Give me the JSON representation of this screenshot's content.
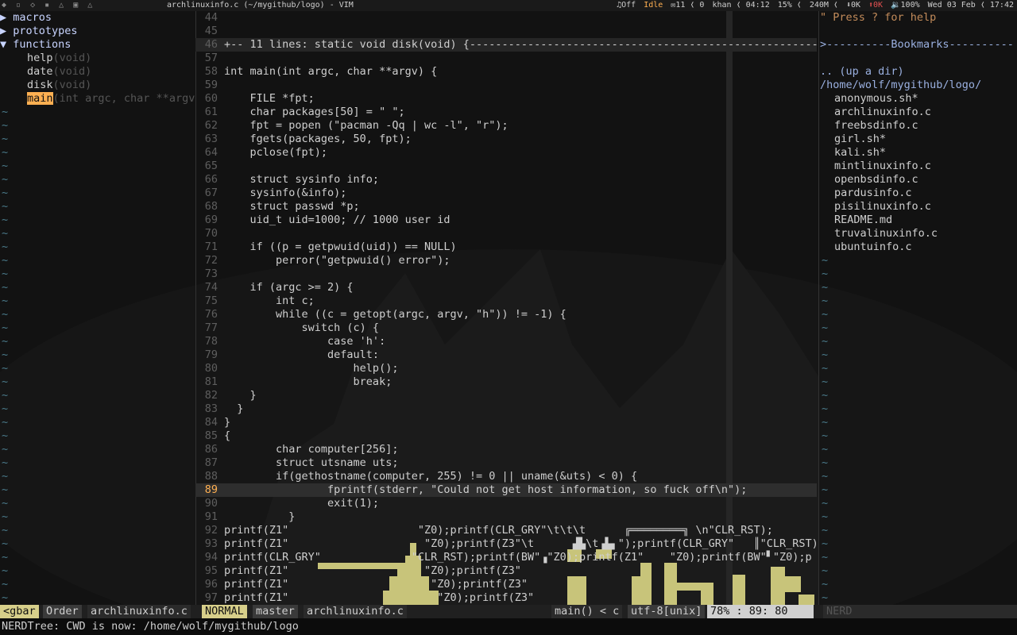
{
  "topbar": {
    "workspaces": "◆ ▫ ◇ ▪ △ ▣ △",
    "window_title": "archlinuxinfo.c (~/mygithub/logo) - VIM",
    "status": [
      {
        "icon": "music-note-icon",
        "text": "♫Off"
      },
      {
        "icon": "state-icon",
        "text": "Idle"
      },
      {
        "icon": "mail-icon",
        "text": "✉11 ❬ 0"
      },
      {
        "icon": "user-icon",
        "text": "khan ❬ 04:12"
      },
      {
        "icon": "cpu-icon",
        "text": "15% ❬"
      },
      {
        "icon": "memory-icon",
        "text": "240M ❬"
      },
      {
        "icon": "download-icon",
        "text": "⬇0K"
      },
      {
        "icon": "upload-icon",
        "text": "⬆0K"
      },
      {
        "icon": "volume-icon",
        "text": "🔉100%"
      },
      {
        "icon": "clock-icon",
        "text": "Wed 03 Feb ❬ 17:42"
      }
    ]
  },
  "tagbar": {
    "groups": [
      {
        "arrow": "▶",
        "label": "macros"
      },
      {
        "arrow": "▶",
        "label": "prototypes"
      },
      {
        "arrow": "▼",
        "label": "functions"
      }
    ],
    "functions": [
      {
        "name": "help",
        "sig": "(void)"
      },
      {
        "name": "date",
        "sig": "(void)"
      },
      {
        "name": "disk",
        "sig": "(void)"
      },
      {
        "name": "main",
        "sig": "(int argc, char **argv",
        "selected": true
      }
    ]
  },
  "editor": {
    "lines": [
      {
        "n": "44",
        "t": ""
      },
      {
        "n": "45",
        "t": ""
      },
      {
        "n": "46",
        "t": "+-- 11 lines: static void disk(void) {-----------------------------------------------------------",
        "fold": true
      },
      {
        "n": "57",
        "t": ""
      },
      {
        "n": "58",
        "t": "int main(int argc, char **argv) {"
      },
      {
        "n": "59",
        "t": ""
      },
      {
        "n": "60",
        "t": "    FILE *fpt;"
      },
      {
        "n": "61",
        "t": "    char packages[50] = \" \";"
      },
      {
        "n": "62",
        "t": "    fpt = popen (\"pacman -Qq | wc -l\", \"r\");"
      },
      {
        "n": "63",
        "t": "    fgets(packages, 50, fpt);"
      },
      {
        "n": "64",
        "t": "    pclose(fpt);"
      },
      {
        "n": "65",
        "t": ""
      },
      {
        "n": "66",
        "t": "    struct sysinfo info;"
      },
      {
        "n": "67",
        "t": "    sysinfo(&info);"
      },
      {
        "n": "68",
        "t": "    struct passwd *p;"
      },
      {
        "n": "69",
        "t": "    uid_t uid=1000; // 1000 user id"
      },
      {
        "n": "70",
        "t": ""
      },
      {
        "n": "71",
        "t": "    if ((p = getpwuid(uid)) == NULL)"
      },
      {
        "n": "72",
        "t": "        perror(\"getpwuid() error\");"
      },
      {
        "n": "73",
        "t": ""
      },
      {
        "n": "74",
        "t": "    if (argc >= 2) {"
      },
      {
        "n": "75",
        "t": "        int c;"
      },
      {
        "n": "76",
        "t": "        while ((c = getopt(argc, argv, \"h\")) != -1) {"
      },
      {
        "n": "77",
        "t": "            switch (c) {"
      },
      {
        "n": "78",
        "t": "                case 'h':"
      },
      {
        "n": "79",
        "t": "                default:"
      },
      {
        "n": "80",
        "t": "                    help();"
      },
      {
        "n": "81",
        "t": "                    break;"
      },
      {
        "n": "82",
        "t": "    }"
      },
      {
        "n": "83",
        "t": "  }"
      },
      {
        "n": "84",
        "t": "}"
      },
      {
        "n": "85",
        "t": "{"
      },
      {
        "n": "86",
        "t": "        char computer[256];"
      },
      {
        "n": "87",
        "t": "        struct utsname uts;"
      },
      {
        "n": "88",
        "t": "        if(gethostname(computer, 255) != 0 || uname(&uts) < 0) {"
      },
      {
        "n": "89",
        "t": "                fprintf(stderr, \"Could not get host information, so fuck off\\n\");",
        "current": true
      },
      {
        "n": "90",
        "t": "                exit(1);"
      },
      {
        "n": "91",
        "t": "          }"
      },
      {
        "n": "92",
        "t": "printf(Z1\"                    \"Z0);printf(CLR_GRY\"\\t\\t\\t      ╔════════╗ \\n\"CLR_RST);"
      },
      {
        "n": "93",
        "t": "printf(Z1\"                     \"Z0);printf(Z3\"\\t      ▟▙\\t▗▙▖\");printf(CLR_GRY\"   ║\"CLR_RST);p"
      },
      {
        "n": "94",
        "t": "printf(CLR_GRY\"              \"CLR_RST);printf(BW\"▗\"Z0);printf(Z1\"    \"Z0);printf(BW\"▘\"Z0);p"
      },
      {
        "n": "95",
        "t": "printf(Z1\"                     \"Z0);printf(Z3\""
      },
      {
        "n": "96",
        "t": "printf(Z1\"                      \"Z0);printf(Z3\""
      },
      {
        "n": "97",
        "t": "printf(Z1\"                       \"Z0);printf(Z3\""
      }
    ]
  },
  "nerdtree": {
    "help": "\" Press ? for help",
    "bookmarks": ">----------Bookmarks----------",
    "up_dir": ".. (up a dir)",
    "cwd": "/home/wolf/mygithub/logo/",
    "files": [
      "anonymous.sh*",
      "archlinuxinfo.c",
      "freebsdinfo.c",
      "girl.sh*",
      "kali.sh*",
      "mintlinuxinfo.c",
      "openbsdinfo.c",
      "pardusinfo.c",
      "pisilinuxinfo.c",
      "README.md",
      "truvalinuxinfo.c",
      "ubuntuinfo.c"
    ]
  },
  "statusline": {
    "tagbar_label": "<gbar",
    "order": "Order",
    "tag_file": "archlinuxinfo.c",
    "mode": "NORMAL",
    "branch": "master",
    "filename": "archlinuxinfo.c",
    "function": "main() < c",
    "encoding": "utf-8[unix]",
    "position": " 78% :  89: 80",
    "nerd": "NERD"
  },
  "cmdline": "NERDTree: CWD is now: /home/wolf/mygithub/logo",
  "colors": {
    "accent": "#ffb052",
    "mode_bg": "#d7cf8a",
    "art": "#c8c47a"
  }
}
